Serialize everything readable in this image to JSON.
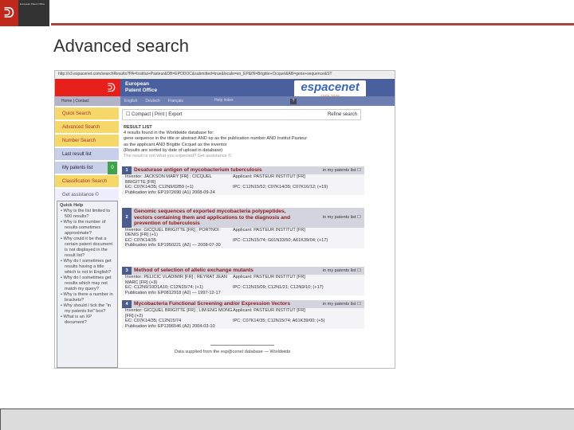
{
  "slide": {
    "title": "Advanced search",
    "logo_text": "European Patent Office"
  },
  "browser": {
    "url": "http://v3.espacenet.com/searchResults?PA=Institut+Pasteur&DB=EPODOC&submitted=true&locale=en_EP&IN=Brigitte+Cicquel&AB=gene+sequence&ST"
  },
  "header": {
    "org": "European",
    "org2": "Patent Office",
    "brand": "espacenet",
    "years": "1998-2008",
    "nav": "Home | Contact",
    "languages": [
      "English",
      "Deutsch",
      "Français"
    ],
    "help_label": "Help index",
    "help_icon": "?"
  },
  "sidebar": {
    "items": [
      {
        "label": "Quick Search"
      },
      {
        "label": "Advanced Search"
      },
      {
        "label": "Number Search"
      },
      {
        "label": "Last result list"
      },
      {
        "label": "My patents list"
      },
      {
        "label": "Classification Search"
      },
      {
        "label": "Get assistance ©"
      }
    ],
    "patents_count": "0",
    "quick_help": {
      "title": "Quick Help",
      "items": [
        "Why is the list limited to 500 results?",
        "Why is the number of results sometimes approximate?",
        "Why could it be that a certain patent document is not displayed in the result list?",
        "Why do I sometimes get results having a title which is not in English?",
        "Why do I sometimes get results which may not match my query?",
        "Why is there a number in brackets?",
        "Why should I tick the \"in my patents list\" box?",
        "What is an XP document?"
      ]
    }
  },
  "toolbar": {
    "compact": "☐ Compact",
    "print": "Print",
    "export": "Export",
    "refine": "Refine search"
  },
  "results": {
    "heading": "RESULT LIST",
    "summary": "4 results found in the Worldwide database for:",
    "query1": "gene sequence in the title or abstract AND ep as the publication number AND Institut Pasteur",
    "query2": "as the applicant AND Brigitte Cicquel as the inventor",
    "sorted": "(Results are sorted by date of upload in database)",
    "assist": "The result is not what you expected? Get assistance ©",
    "in_list": "in my patents list ☐",
    "items": [
      {
        "num": "1",
        "title": "Desaturase antigen of mycobacterium tuberculosis",
        "inventor": "Inventor: JACKSON MARY [FR] ; CICQUEL BRIGITTE [FR]",
        "applicant": "Applicant: PASTEUR INSTITUT [FR]",
        "ec": "EC: C07K14/35; C12N9/02B9 (+1)",
        "ipc": "IPC: C12N15/52; C07K14/35; C07K16/12; (+19)",
        "pub": "Publication info: EP1972690 (A1) 2008-09-24"
      },
      {
        "num": "2",
        "title": "Genomic sequences of exported mycobacteria polypeptides, vectors containing them and applications to the diagnosis and prevention of tuberculosis",
        "inventor": "Inventor: GICQUEL BRIGITTE [FR] ; PORTNOI DENIS [FR] (+1)",
        "applicant": "Applicant: PASTEUR INSTITUT [FR]",
        "ec": "EC: C07K14/35",
        "ipc": "IPC: C12N15/74; G01N33/50; A61K39/04; (+17)",
        "pub": "Publication info: EP1950221 (A2) — 2008-07-30"
      },
      {
        "num": "3",
        "title": "Method of selection of allelic exchange mutants",
        "inventor": "Inventor: PELICIC VLADIMIR [FR] ; REYRAT JEAN MARC [FR] (+3)",
        "applicant": "Applicant: PASTEUR INSTITUT [FR]",
        "ec": "EC: C12N9/10D1A10; C12N15/74; (+1)",
        "ipc": "IPC: C12N15/09; C12N1/21; C12N9/10; (+17)",
        "pub": "Publication info: EP0812918 (A2) — 1997-12-17"
      },
      {
        "num": "4",
        "title": "Mycobacteria Functional Screening and/or Expression Vectors",
        "inventor": "Inventor: GICQUEL BRIGITTE [FR] ; LIM ENG MONG [FR] (+2)",
        "applicant": "Applicant: PASTEUR INSTITUT [FR]",
        "ec": "EC: C07K14/35; C12N15/74",
        "ipc": "IPC: C07K14/35; C12N15/74; A61K39/00; (+5)",
        "pub": "Publication info: EP1396546 (A2) 2004-03-10"
      }
    ]
  },
  "footer": {
    "text": "Data supplied from the esp@cenet database — Worldwide"
  }
}
